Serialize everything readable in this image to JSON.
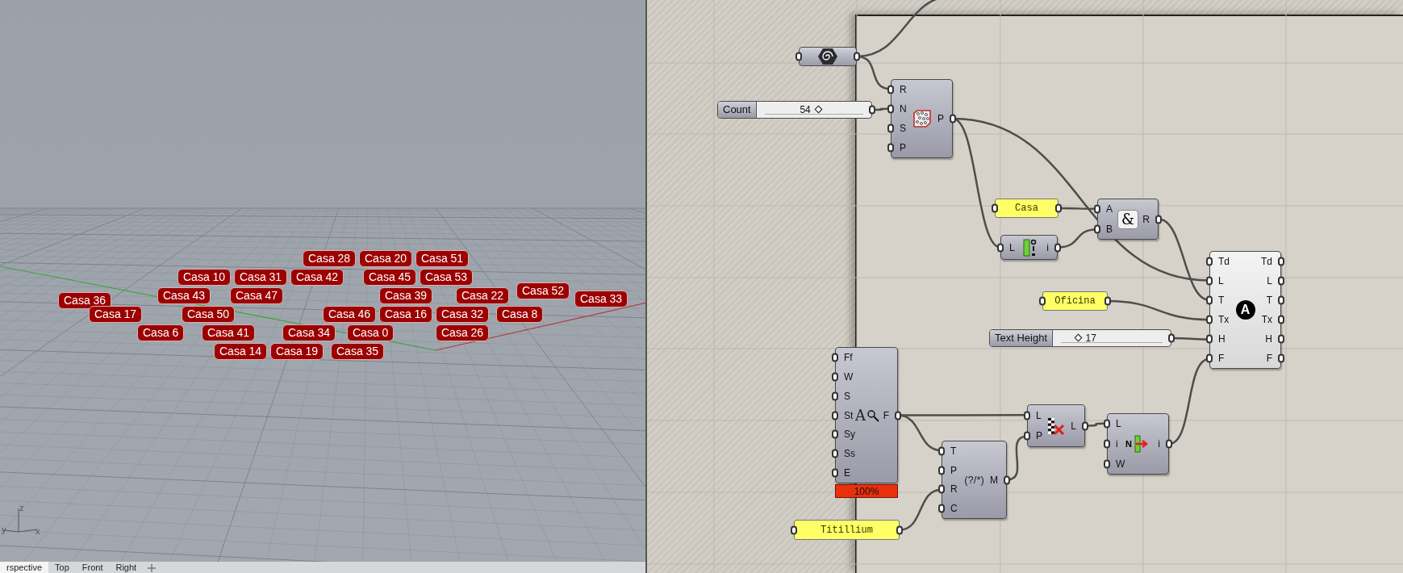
{
  "viewport": {
    "tags": [
      "Casa 28",
      "Casa 20",
      "Casa 51",
      "Casa 10",
      "Casa 31",
      "Casa 42",
      "Casa 45",
      "Casa 53",
      "Casa 36",
      "Casa 43",
      "Casa 47",
      "Casa 39",
      "Casa 22",
      "Casa 52",
      "Casa 33",
      "Casa 17",
      "Casa 50",
      "Casa 46",
      "Casa 16",
      "Casa 32",
      "Casa 8",
      "Casa 6",
      "Casa 41",
      "Casa 34",
      "Casa 0",
      "Casa 26",
      "Casa 14",
      "Casa 19",
      "Casa 35"
    ],
    "axes": [
      "z",
      "y",
      "x"
    ],
    "tabs": [
      {
        "label": "rspective",
        "selected": true
      },
      {
        "label": "Top",
        "selected": false
      },
      {
        "label": "Front",
        "selected": false
      },
      {
        "label": "Right",
        "selected": false
      }
    ]
  },
  "canvas": {
    "nodes": [
      {
        "kind": "param"
      },
      {
        "kind": "component",
        "inputs": [
          "R",
          "N",
          "S",
          "P"
        ],
        "outputs": [
          "P"
        ]
      },
      {
        "kind": "slider",
        "label": "Count",
        "value": "54",
        "level": 0.54
      },
      {
        "kind": "panel",
        "text": "Casa"
      },
      {
        "kind": "component",
        "inputs": [
          "L"
        ],
        "outputs": [
          "i"
        ]
      },
      {
        "kind": "component",
        "inputs": [
          "A",
          "B"
        ],
        "outputs": [
          "R"
        ],
        "symbol": "&"
      },
      {
        "kind": "component",
        "inputs": [
          "Td",
          "L",
          "T",
          "Tx",
          "H",
          "F"
        ],
        "outputs": [
          "Td",
          "L",
          "T",
          "Tx",
          "H",
          "F"
        ],
        "symbol": "A"
      },
      {
        "kind": "panel",
        "text": "Oficina"
      },
      {
        "kind": "slider",
        "label": "Text Height",
        "value": "17",
        "level": 0.17
      },
      {
        "kind": "component",
        "inputs": [
          "Ff",
          "W",
          "S",
          "St",
          "Sy",
          "Ss",
          "E"
        ],
        "outputs": [
          "F"
        ],
        "symbol": "A",
        "badge": "100%"
      },
      {
        "kind": "component",
        "inputs": [
          "T",
          "P",
          "R",
          "C"
        ],
        "outputs": [
          "M"
        ],
        "symbol": "(?/*)"
      },
      {
        "kind": "component",
        "inputs": [
          "L",
          "P"
        ],
        "outputs": [
          "L"
        ]
      },
      {
        "kind": "component",
        "inputs": [
          "L",
          "i",
          "W"
        ],
        "outputs": [
          "i"
        ],
        "symbol": "N"
      },
      {
        "kind": "panel",
        "text": "Titillium"
      }
    ]
  }
}
